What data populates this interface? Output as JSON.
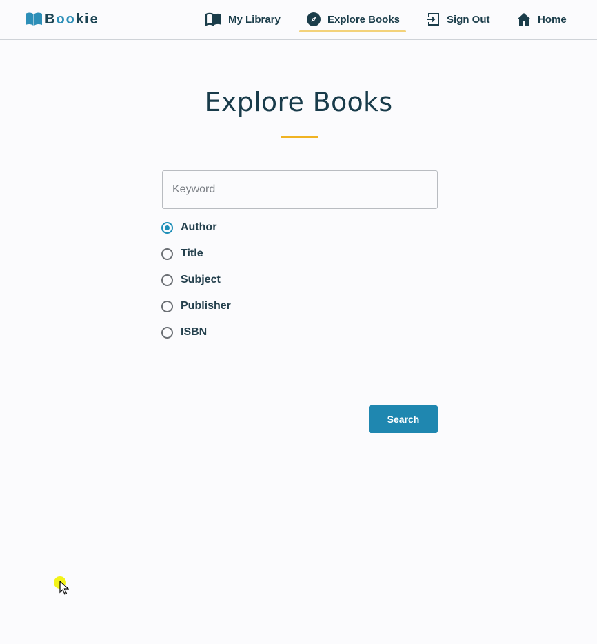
{
  "brand": {
    "b": "B",
    "oo": "oo",
    "kie": "kie"
  },
  "nav": {
    "library": "My Library",
    "explore": "Explore Books",
    "signout": "Sign Out",
    "home": "Home"
  },
  "page": {
    "title": "Explore Books"
  },
  "search": {
    "placeholder": "Keyword",
    "value": "",
    "options": [
      "Author",
      "Title",
      "Subject",
      "Publisher",
      "ISBN"
    ],
    "selected": "Author",
    "button": "Search"
  },
  "colors": {
    "accent": "#1f87b0",
    "underline": "#f0b323",
    "nav_active_underline": "#f3d27a",
    "text_dark": "#183b4a"
  },
  "icons": {
    "brand": "open-book-icon",
    "library": "book-icon",
    "explore": "compass-icon",
    "signout": "sign-out-icon",
    "home": "home-icon"
  }
}
